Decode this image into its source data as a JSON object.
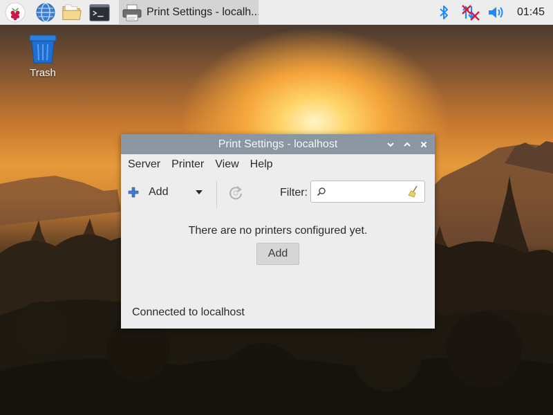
{
  "panel": {
    "launchers": [
      {
        "icon": "raspberry-menu-icon"
      },
      {
        "icon": "web-browser-icon"
      },
      {
        "icon": "file-manager-icon"
      },
      {
        "icon": "terminal-icon"
      }
    ],
    "task": {
      "icon": "printer-icon",
      "label": "Print Settings - localh..."
    },
    "tray": [
      {
        "icon": "bluetooth-icon"
      },
      {
        "icon": "network-disconnected-icon"
      },
      {
        "icon": "volume-icon"
      }
    ],
    "clock": "01:45"
  },
  "desktop": {
    "trash_label": "Trash"
  },
  "window": {
    "title": "Print Settings - localhost",
    "menu": [
      "Server",
      "Printer",
      "View",
      "Help"
    ],
    "toolbar": {
      "add_label": "Add",
      "filter_label": "Filter:",
      "filter_value": ""
    },
    "empty_message": "There are no printers configured yet.",
    "add_button": "Add",
    "status": "Connected to localhost"
  },
  "colors": {
    "titlebar": "#8a96a2",
    "panel": "#ededed",
    "accent_blue": "#1a8cff",
    "alert_red": "#d81b3c"
  }
}
